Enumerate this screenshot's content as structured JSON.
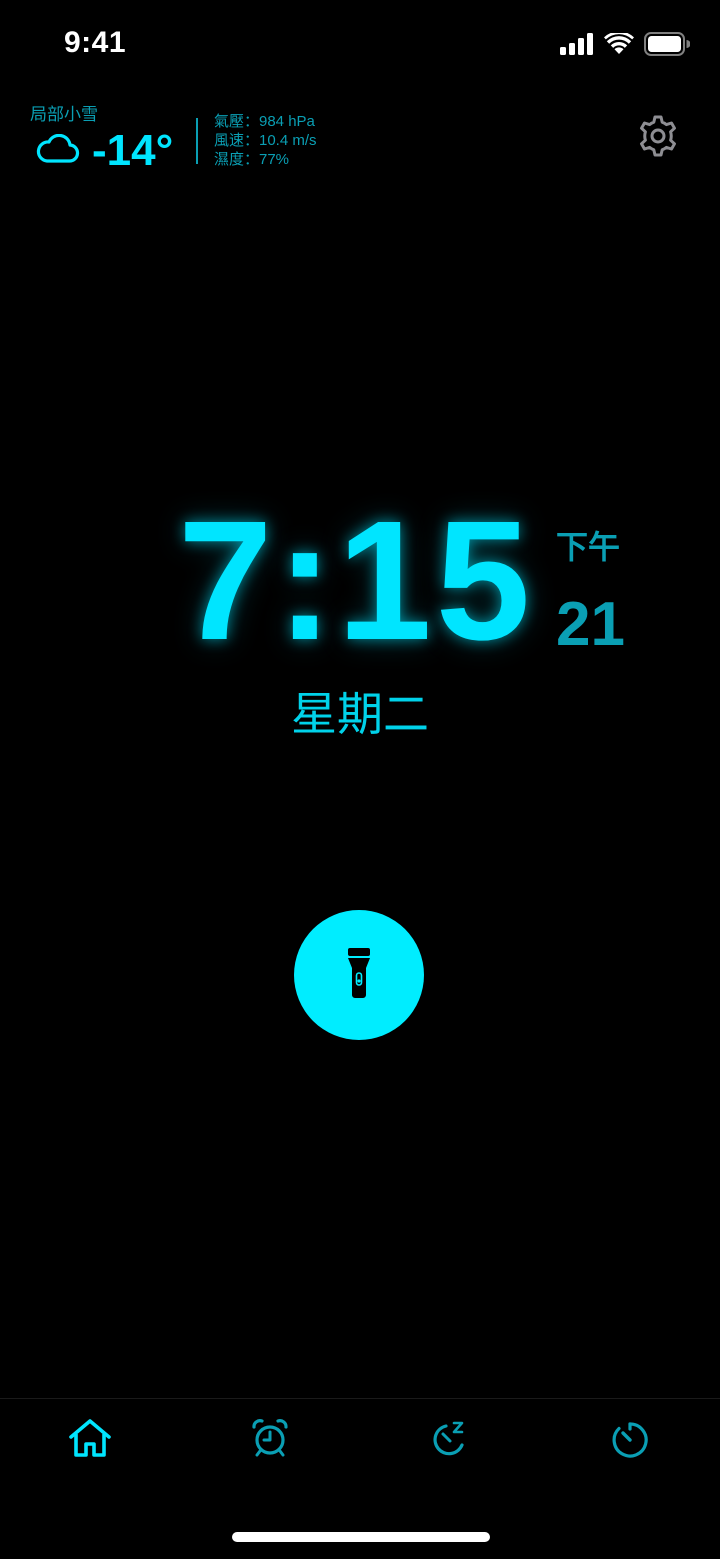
{
  "status_bar": {
    "time": "9:41",
    "icons": [
      "cellular-signal-icon",
      "wifi-icon",
      "battery-icon"
    ]
  },
  "weather": {
    "condition": "局部小雪",
    "icon": "cloud-icon",
    "temperature": "-14°",
    "pressure": "氣壓：984 hPa",
    "wind": "風速：10.4 m/s",
    "humidity": "濕度：77%"
  },
  "settings": {
    "icon": "gear-icon"
  },
  "clock": {
    "time": "7:15",
    "ampm": "下午",
    "seconds": "21",
    "weekday": "星期二"
  },
  "flashlight": {
    "icon": "flashlight-icon"
  },
  "tab_bar": {
    "tabs": [
      {
        "name": "home",
        "icon": "home-icon",
        "active": true
      },
      {
        "name": "alarm",
        "icon": "alarm-clock-icon",
        "active": false
      },
      {
        "name": "sleep",
        "icon": "sleep-timer-icon",
        "active": false
      },
      {
        "name": "timer",
        "icon": "timer-icon",
        "active": false
      }
    ]
  },
  "colors": {
    "accent": "#00e5ff",
    "accent_dim": "#0a9fb4",
    "background": "#000000",
    "settings_gray": "#8e8e93"
  }
}
